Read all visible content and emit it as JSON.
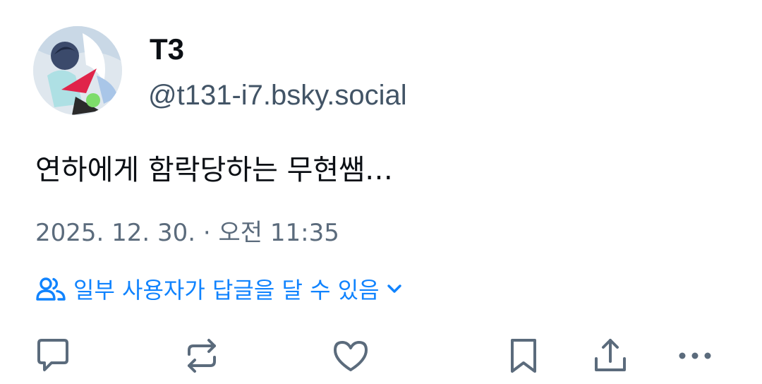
{
  "post": {
    "author": {
      "display_name": "T3",
      "handle": "@t131-i7.bsky.social",
      "avatar_icon": "avatar-image"
    },
    "text": "연하에게 함락당하는 무현쌤…",
    "timestamp": "2025. 12. 30. · 오전 11:35",
    "reply_setting": {
      "label": "일부 사용자가 답글을 달 수 있음",
      "icon": "people-icon",
      "color": "#1083fe"
    }
  },
  "actions": [
    {
      "name": "reply",
      "icon": "comment-icon"
    },
    {
      "name": "repost",
      "icon": "repost-icon"
    },
    {
      "name": "like",
      "icon": "heart-icon"
    },
    {
      "name": "bookmark",
      "icon": "bookmark-icon"
    },
    {
      "name": "share",
      "icon": "share-icon"
    },
    {
      "name": "more",
      "icon": "more-icon"
    }
  ],
  "colors": {
    "text_primary": "#0b0f14",
    "text_secondary": "#5b6b7c",
    "accent": "#1083fe",
    "icon": "#5b6b7c"
  }
}
